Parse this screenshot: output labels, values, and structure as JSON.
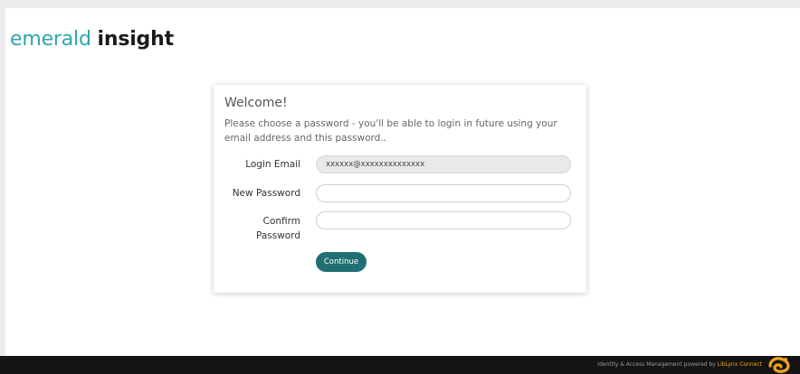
{
  "header": {
    "logo_light": "emerald",
    "logo_bold": "insight"
  },
  "form": {
    "title": "Welcome!",
    "intro": "Please choose a password - you'll be able to login in future using your email address and this password..",
    "login_email_label": "Login Email",
    "login_email_value": "xxxxxx@xxxxxxxxxxxxxx",
    "new_password_label": "New Password",
    "new_password_value": "",
    "confirm_password_label": "Confirm Password",
    "confirm_password_value": "",
    "continue_label": "Continue"
  },
  "footer": {
    "text_prefix": "Identity & Access Management powered by ",
    "brand": "LibLynx Connect",
    "icon": "liblynx-logo-icon"
  },
  "colors": {
    "accent": "#2fa6ae",
    "button": "#1f6f73",
    "footer_bg": "#141414",
    "footer_brand": "#f0a21d"
  }
}
